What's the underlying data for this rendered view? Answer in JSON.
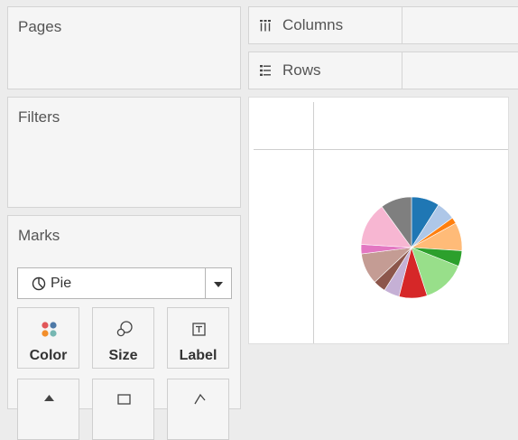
{
  "shelves": {
    "pages": {
      "title": "Pages"
    },
    "filters": {
      "title": "Filters"
    },
    "columns": {
      "label": "Columns",
      "icon": "columns-icon"
    },
    "rows": {
      "label": "Rows",
      "icon": "rows-icon"
    }
  },
  "marks": {
    "title": "Marks",
    "mark_type": {
      "label": "Pie",
      "icon": "pie-icon"
    },
    "buttons": [
      {
        "label": "Color",
        "icon": "color-icon"
      },
      {
        "label": "Size",
        "icon": "size-icon"
      },
      {
        "label": "Label",
        "icon": "label-icon"
      },
      {
        "label": "",
        "icon": "detail-icon"
      },
      {
        "label": "",
        "icon": "tooltip-icon"
      },
      {
        "label": "",
        "icon": "angle-icon"
      }
    ]
  },
  "colors": {
    "color_dots": [
      "#e15759",
      "#4e79a7",
      "#f28e2b",
      "#76b7b2"
    ]
  },
  "chart_data": {
    "type": "pie",
    "title": "",
    "values": [
      9,
      6,
      2,
      9,
      5,
      14,
      9,
      5,
      4,
      10,
      3,
      14,
      10
    ],
    "colors": [
      "#1f77b4",
      "#aec7e8",
      "#ff7f0e",
      "#ffbb78",
      "#2ca02c",
      "#98df8a",
      "#d62728",
      "#c5b0d5",
      "#8c564b",
      "#c49c94",
      "#e377c2",
      "#f7b6d2",
      "#7f7f7f",
      "#bcbd22"
    ]
  }
}
